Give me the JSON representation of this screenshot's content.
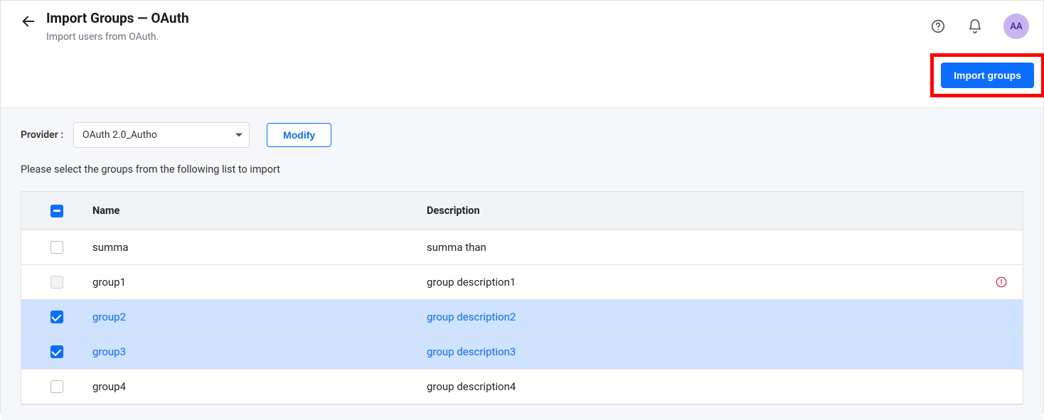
{
  "header": {
    "title": "Import Groups — OAuth",
    "subtitle": "Import users from OAuth.",
    "avatar_initials": "AA"
  },
  "actions": {
    "import_button": "Import groups"
  },
  "provider": {
    "label": "Provider :",
    "selected": "OAuth 2.0_Autho",
    "modify_button": "Modify"
  },
  "instruction": "Please select the groups from the following list to import",
  "table": {
    "columns": {
      "name": "Name",
      "description": "Description"
    },
    "header_check_state": "indeterminate",
    "rows": [
      {
        "name": "summa",
        "description": "summa than",
        "checked": false,
        "disabled": false,
        "warn": false
      },
      {
        "name": "group1",
        "description": "group description1",
        "checked": false,
        "disabled": true,
        "warn": true
      },
      {
        "name": "group2",
        "description": "group description2",
        "checked": true,
        "disabled": false,
        "warn": false
      },
      {
        "name": "group3",
        "description": "group description3",
        "checked": true,
        "disabled": false,
        "warn": false
      },
      {
        "name": "group4",
        "description": "group description4",
        "checked": false,
        "disabled": false,
        "warn": false
      }
    ]
  }
}
